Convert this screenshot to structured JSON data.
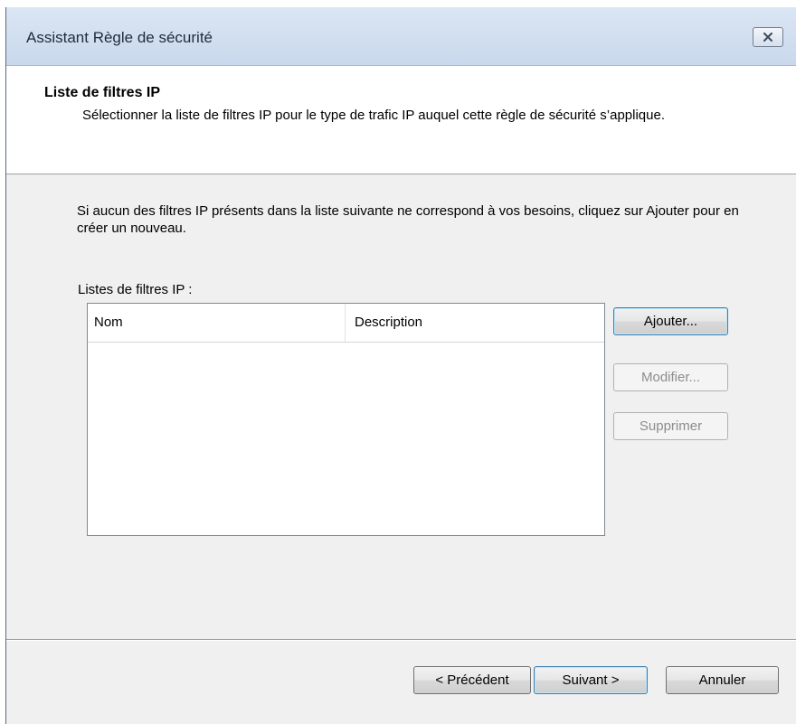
{
  "window": {
    "title": "Assistant Règle de sécurité"
  },
  "header": {
    "title": "Liste de filtres IP",
    "description": "Sélectionner la liste de filtres IP pour le type de trafic IP auquel cette règle de sécurité s’applique."
  },
  "body": {
    "intro": "Si aucun des filtres IP présents dans la liste suivante ne correspond à vos besoins, cliquez sur Ajouter pour en créer un nouveau.",
    "list_label": "Listes de filtres IP :"
  },
  "list": {
    "columns": [
      "Nom",
      "Description"
    ],
    "rows": []
  },
  "side_buttons": {
    "add": "Ajouter...",
    "modify": "Modifier...",
    "delete": "Supprimer"
  },
  "footer": {
    "previous": "< Précédent",
    "next": "Suivant >",
    "cancel": "Annuler"
  },
  "icons": {
    "close": "close-icon"
  }
}
